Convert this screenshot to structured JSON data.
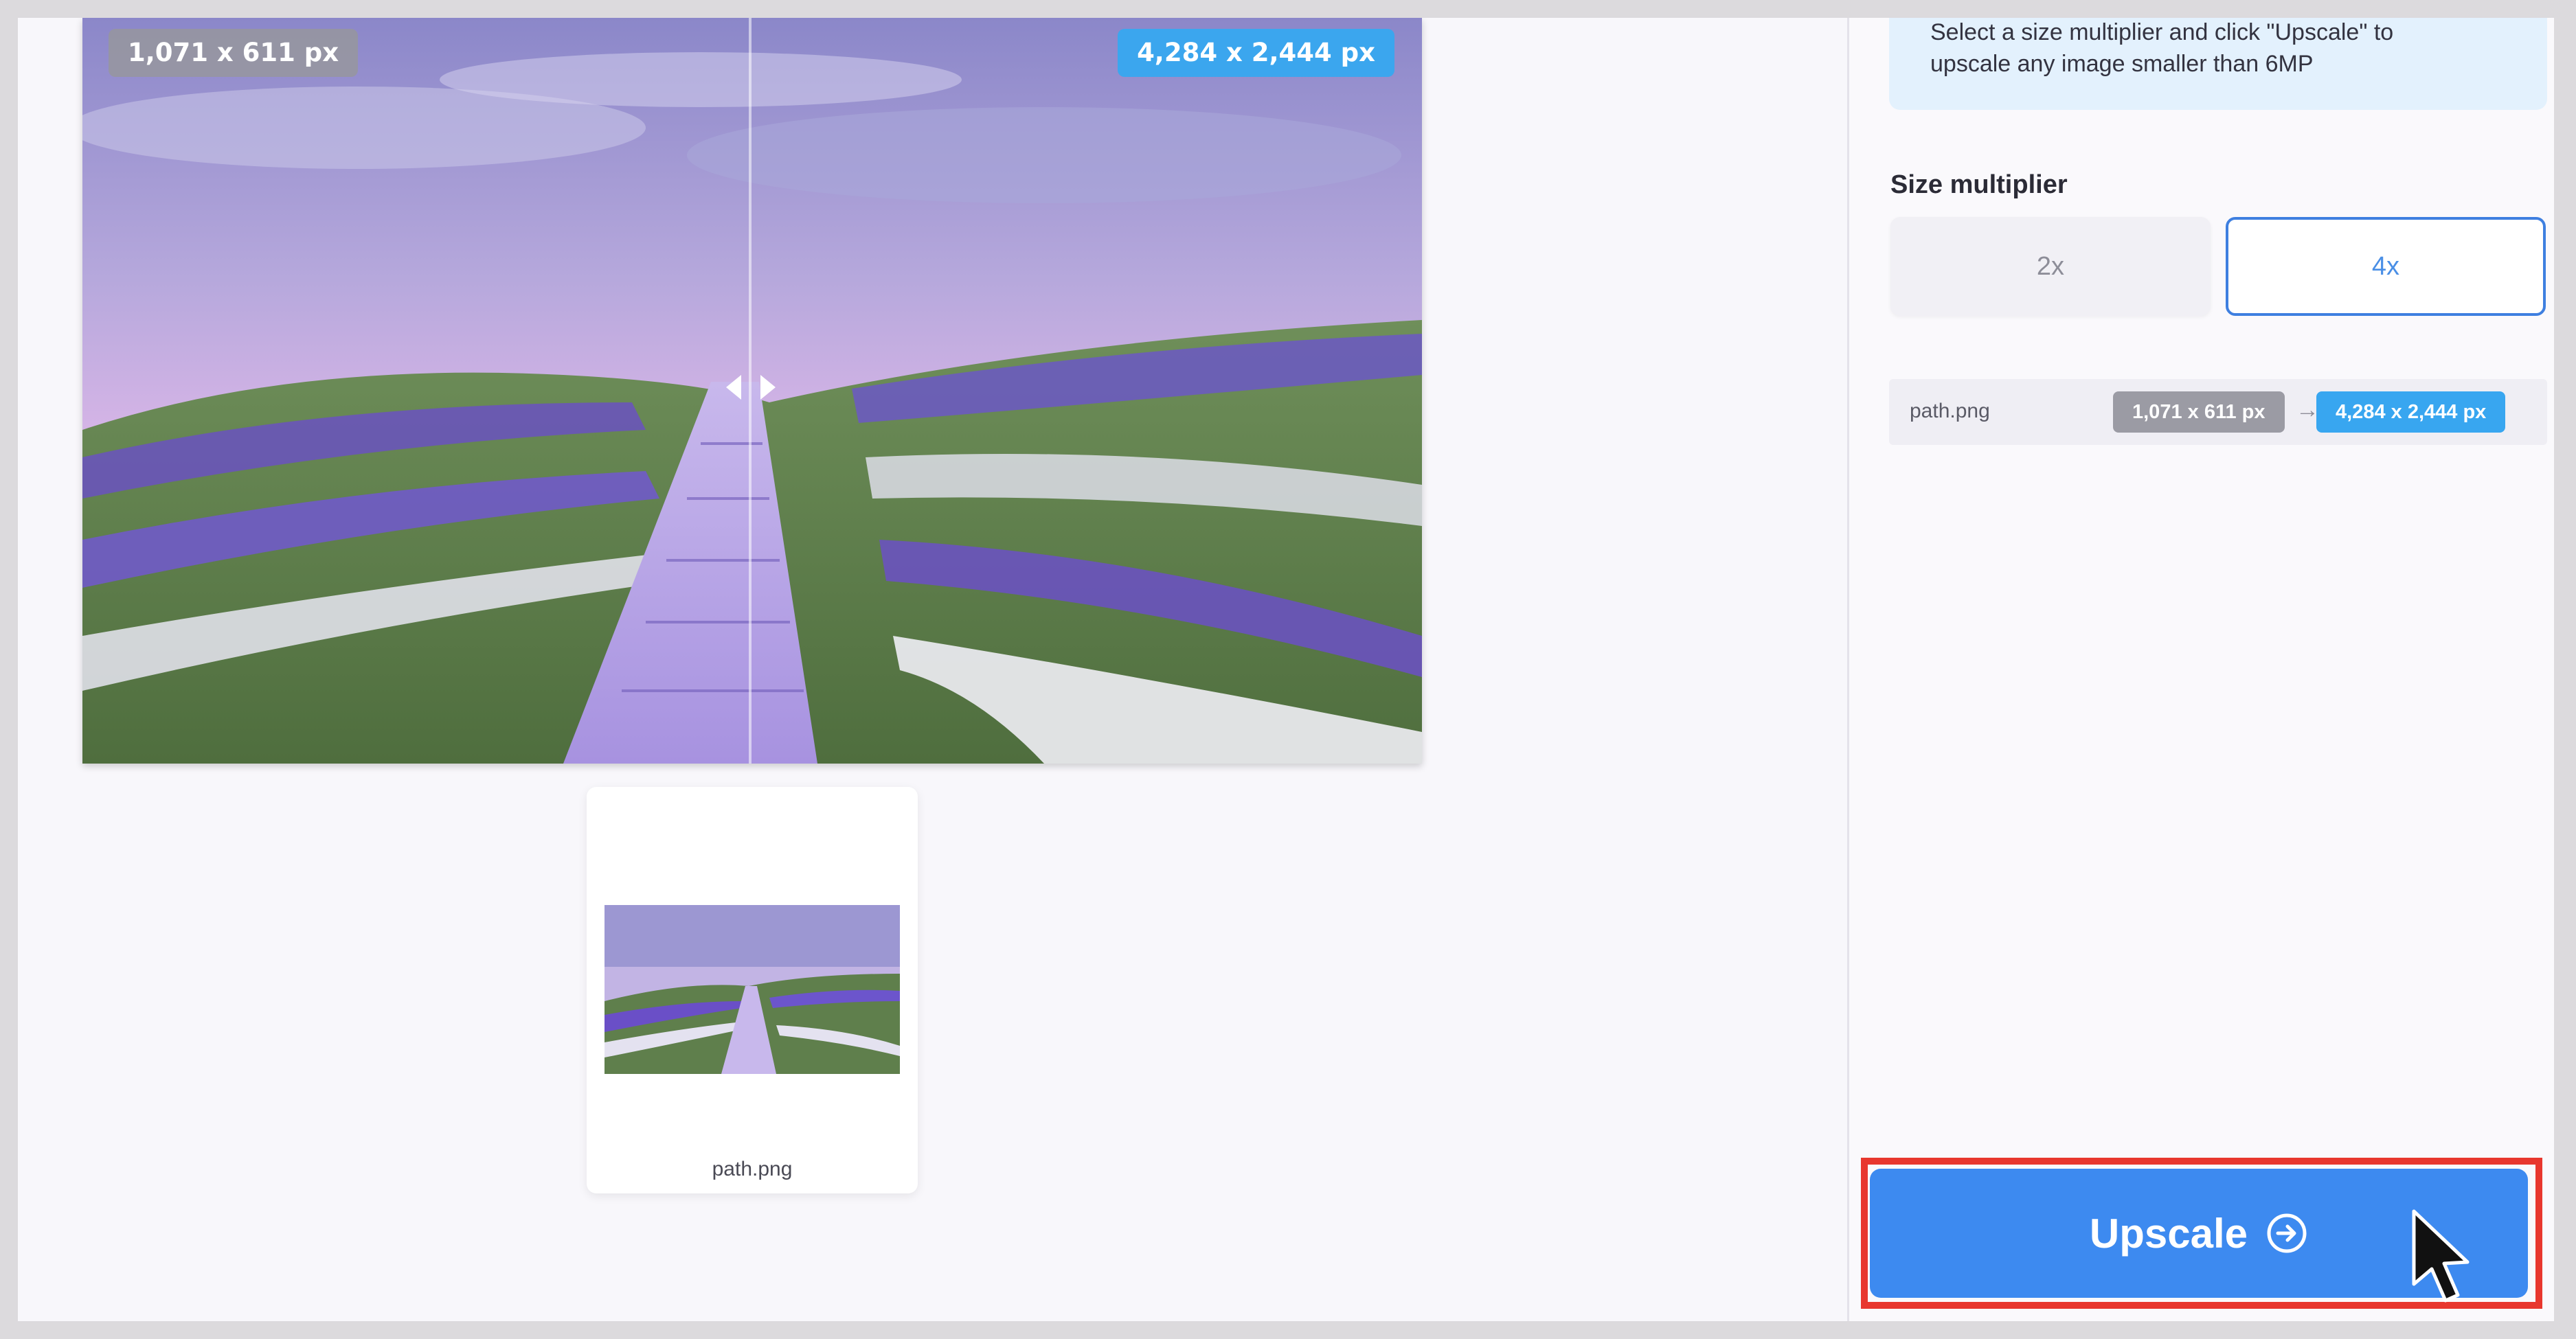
{
  "preview": {
    "original_size": "1,071 x 611 px",
    "upscaled_size": "4,284 x 2,444 px"
  },
  "thumbnail": {
    "file_name": "path.png"
  },
  "panel": {
    "info_line1": "Select a size multiplier and click \"Upscale\" to",
    "info_line2": "upscale any image smaller than 6MP",
    "size_label": "Size multiplier",
    "multipliers": [
      {
        "label": "2x",
        "selected": false
      },
      {
        "label": "4x",
        "selected": true
      }
    ],
    "file_row": {
      "name": "path.png",
      "from": "1,071 x 611 px",
      "arrow": "→",
      "to": "4,284 x 2,444 px"
    },
    "upscale_label": "Upscale"
  },
  "colors": {
    "accent": "#3d8af0",
    "badge_new": "#38a6f0",
    "highlight": "#e8372e",
    "info_bg": "#e3f1fd"
  },
  "icons": [
    "arrow-right-circle-icon",
    "chevron-left-icon",
    "chevron-right-icon",
    "mouse-cursor-icon"
  ]
}
